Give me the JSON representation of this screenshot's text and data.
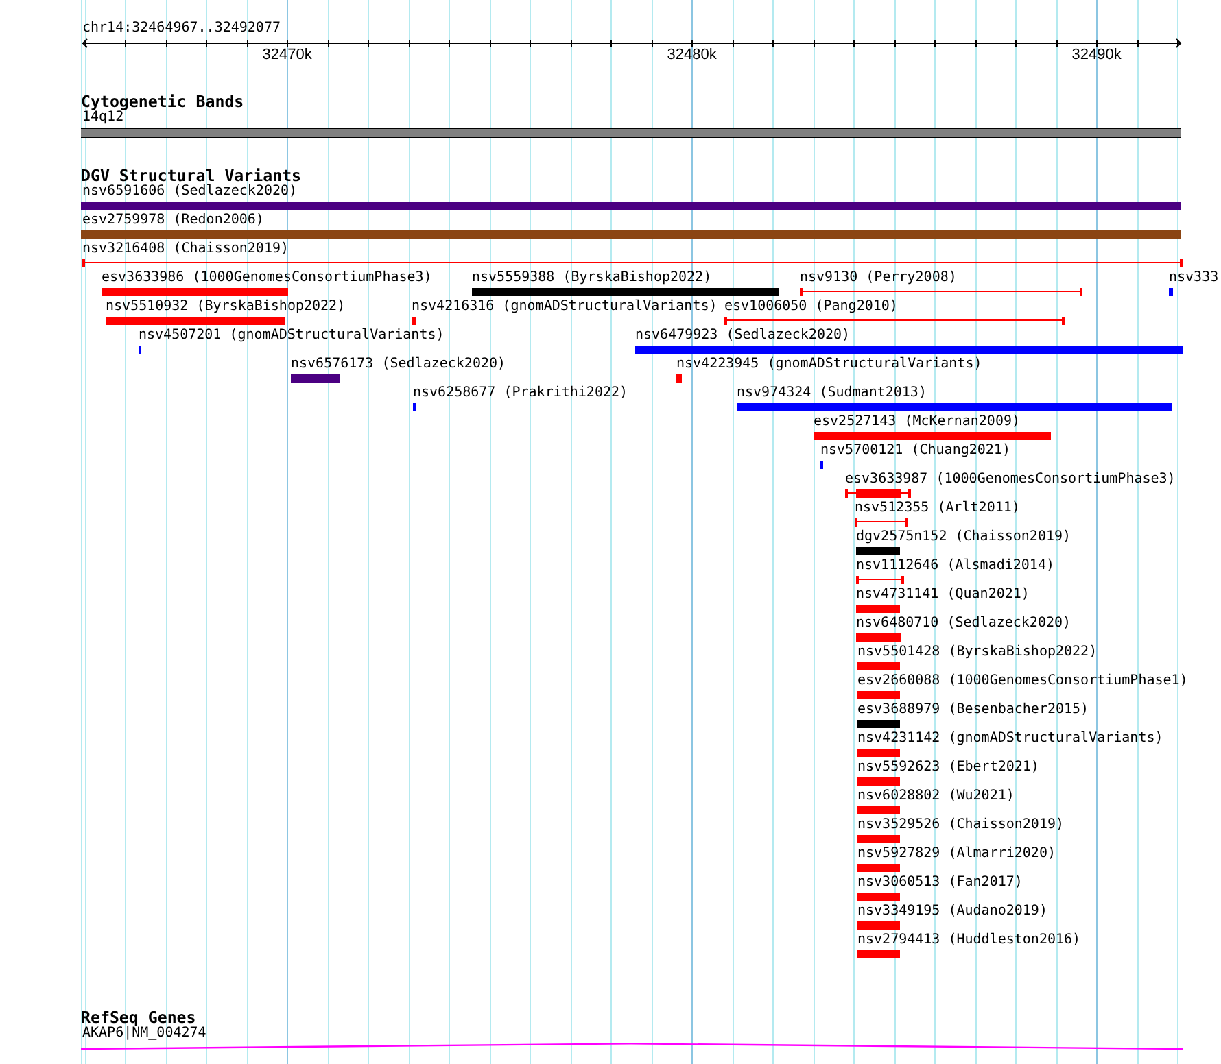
{
  "ruler": {
    "region": "chr14:32464967..32492077",
    "ticks": [
      "32470k",
      "32480k",
      "32490k"
    ]
  },
  "cytogenetic_bands": {
    "title": "Cytogenetic Bands",
    "bands": [
      {
        "label": "14q12"
      }
    ]
  },
  "structural_variants": {
    "title": "DGV Structural Variants",
    "features": [
      {
        "label": "nsv6591606 (Sedlazeck2020)",
        "kind": "bar",
        "color": "#4b0082"
      },
      {
        "label": "esv2759978 (Redon2006)",
        "kind": "bar",
        "color": "#8b4513"
      },
      {
        "label": "nsv3216408 (Chaisson2019)",
        "kind": "line",
        "color": "#ff0000"
      },
      {
        "label": "esv3633986 (1000GenomesConsortiumPhase3)",
        "kind": "bar",
        "color": "#ff0000"
      },
      {
        "label": "nsv5559388 (ByrskaBishop2022)",
        "kind": "bar",
        "color": "#000000"
      },
      {
        "label": "nsv9130 (Perry2008)",
        "kind": "line",
        "color": "#ff0000"
      },
      {
        "label": "nsv333",
        "kind": "bar",
        "color": "#0000ff"
      },
      {
        "label": "nsv5510932 (ByrskaBishop2022)",
        "kind": "bar",
        "color": "#ff0000"
      },
      {
        "label": "nsv4216316 (gnomADStructuralVariants)",
        "kind": "bar",
        "color": "#ff0000"
      },
      {
        "label": "esv1006050 (Pang2010)",
        "kind": "line",
        "color": "#ff0000"
      },
      {
        "label": "nsv4507201 (gnomADStructuralVariants)",
        "kind": "bar",
        "color": "#0000ff"
      },
      {
        "label": "nsv6479923 (Sedlazeck2020)",
        "kind": "bar",
        "color": "#0000ff"
      },
      {
        "label": "nsv6576173 (Sedlazeck2020)",
        "kind": "bar",
        "color": "#4b0082"
      },
      {
        "label": "nsv4223945 (gnomADStructuralVariants)",
        "kind": "bar",
        "color": "#ff0000"
      },
      {
        "label": "nsv6258677 (Prakrithi2022)",
        "kind": "bar",
        "color": "#0000ff"
      },
      {
        "label": "nsv974324 (Sudmant2013)",
        "kind": "bar",
        "color": "#0000ff"
      },
      {
        "label": "esv2527143 (McKernan2009)",
        "kind": "bar",
        "color": "#ff0000"
      },
      {
        "label": "nsv5700121 (Chuang2021)",
        "kind": "bar",
        "color": "#0000ff"
      },
      {
        "label": "esv3633987 (1000GenomesConsortiumPhase3)",
        "kind": "linebar",
        "color": "#ff0000"
      },
      {
        "label": "nsv512355 (Arlt2011)",
        "kind": "line",
        "color": "#ff0000"
      },
      {
        "label": "dgv2575n152 (Chaisson2019)",
        "kind": "bar",
        "color": "#000000"
      },
      {
        "label": "nsv1112646 (Alsmadi2014)",
        "kind": "line",
        "color": "#ff0000"
      },
      {
        "label": "nsv4731141 (Quan2021)",
        "kind": "bar",
        "color": "#ff0000"
      },
      {
        "label": "nsv6480710 (Sedlazeck2020)",
        "kind": "bar",
        "color": "#ff0000"
      },
      {
        "label": "nsv5501428 (ByrskaBishop2022)",
        "kind": "bar",
        "color": "#ff0000"
      },
      {
        "label": "esv2660088 (1000GenomesConsortiumPhase1)",
        "kind": "bar",
        "color": "#ff0000"
      },
      {
        "label": "esv3688979 (Besenbacher2015)",
        "kind": "bar",
        "color": "#000000"
      },
      {
        "label": "nsv4231142 (gnomADStructuralVariants)",
        "kind": "bar",
        "color": "#ff0000"
      },
      {
        "label": "nsv5592623 (Ebert2021)",
        "kind": "bar",
        "color": "#ff0000"
      },
      {
        "label": "nsv6028802 (Wu2021)",
        "kind": "bar",
        "color": "#ff0000"
      },
      {
        "label": "nsv3529526 (Chaisson2019)",
        "kind": "bar",
        "color": "#ff0000"
      },
      {
        "label": "nsv5927829 (Almarri2020)",
        "kind": "bar",
        "color": "#ff0000"
      },
      {
        "label": "nsv3060513 (Fan2017)",
        "kind": "bar",
        "color": "#ff0000"
      },
      {
        "label": "nsv3349195 (Audano2019)",
        "kind": "bar",
        "color": "#ff0000"
      },
      {
        "label": "nsv2794413 (Huddleston2016)",
        "kind": "bar",
        "color": "#ff0000"
      }
    ]
  },
  "refseq_genes": {
    "title": "RefSeq Genes",
    "genes": [
      {
        "label": "AKAP6|NM_004274"
      }
    ]
  }
}
